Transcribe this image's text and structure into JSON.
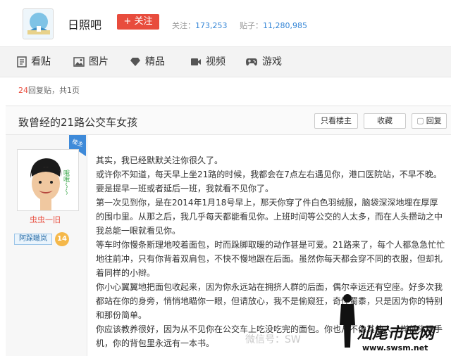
{
  "header": {
    "forum_name": "日照吧",
    "follow_label": "+ 关注",
    "stats": [
      {
        "label": "关注：",
        "value": "173,253"
      },
      {
        "label": "贴子：",
        "value": "11,280,985"
      }
    ]
  },
  "tabs": [
    {
      "label": "看贴",
      "icon": "document-icon"
    },
    {
      "label": "图片",
      "icon": "image-icon"
    },
    {
      "label": "精品",
      "icon": "diamond-icon"
    },
    {
      "label": "视频",
      "icon": "video-icon"
    },
    {
      "label": "游戏",
      "icon": "gamepad-icon"
    }
  ],
  "reply_info": {
    "count": "24",
    "text": "回复贴，共1页"
  },
  "post": {
    "title": "致曾经的21路公交车女孩",
    "buttons": {
      "only_op": "只看楼主",
      "favorite": "收藏",
      "reply": "回复"
    },
    "author": {
      "badge": "楼主",
      "name": "虫虫一旧",
      "level_name": "阿跺瞰岚",
      "level": "14",
      "avatar_text": "哦哦～～"
    },
    "paragraphs": [
      "其实，我已经默默关注你很久了。",
      "或许你不知道，每天早上坐21路的时候，我都会在7点左右遇见你，港口医院站，不早不晚。要是提早一班或者延后一班，我就看不见你了。",
      "第一次见到你，是在2014年1月18号早上，那天你穿了件白色羽绒服，脑袋深深地埋在厚厚的围巾里。从那之后，我几乎每天都能看见你。上班时间等公交的人太多，而在人头攒动之中我总能一眼就看见你。",
      "等车时你慢条斯理地咬着面包，时而跺脚取暖的动作甚是可爱。21路来了，每个人都急急忙忙地往前冲，只有你背着双肩包，不快不慢地跟在后面。虽然你每天都会穿不同的衣服，但却扎着同样的小辫。",
      "你小心翼翼地把面包收起来，因为你永远站在拥挤人群的后面，偶尔幸运还有空座。好多次我都站在你的身旁，悄悄地瞄你一眼，但请放心，我不是偷窥狂，奇怪蜀黍，只是因为你的特别和那份简单。",
      "你应该教养很好，因为从不见你在公交车上吃没吃完的面包。你也从不像其他人一样低头玩手机，你的背包里永远有一本书。"
    ]
  },
  "watermarks": {
    "weixin": "微信号：SW",
    "site": "汕尾市民网",
    "url": "www.swsm.net"
  }
}
